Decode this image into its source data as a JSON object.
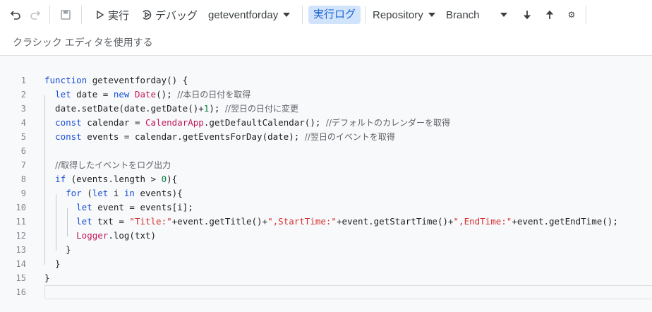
{
  "toolbar": {
    "undo_icon": "undo-icon",
    "redo_icon": "redo-icon",
    "save_icon": "save-icon",
    "run_label": "実行",
    "debug_label": "デバッグ",
    "function_select": "geteventforday",
    "log_label": "実行ログ",
    "repository_label": "Repository",
    "branch_label": "Branch",
    "download_icon": "arrow-down-icon",
    "upload_icon": "arrow-up-icon",
    "settings_icon": "gear-icon"
  },
  "classic_editor_label": "クラシック エディタを使用する",
  "colors": {
    "keyword": "#1a4fd7",
    "string": "#d32f2f",
    "class": "#c2185b",
    "number": "#0b8043",
    "comment": "#5f6368",
    "active_button_bg": "#d2e3fc",
    "active_button_text": "#1967d2"
  },
  "editor": {
    "lines": [
      {
        "num": "1",
        "tokens": [
          {
            "t": "kw",
            "v": "function"
          },
          {
            "t": "",
            "v": " geteventforday() {"
          }
        ]
      },
      {
        "num": "2",
        "tokens": [
          {
            "t": "",
            "v": "  "
          },
          {
            "t": "kw",
            "v": "let"
          },
          {
            "t": "",
            "v": " date = "
          },
          {
            "t": "kw",
            "v": "new"
          },
          {
            "t": "",
            "v": " "
          },
          {
            "t": "cls",
            "v": "Date"
          },
          {
            "t": "",
            "v": "(); "
          },
          {
            "t": "cm",
            "v": "//本日の日付を取得"
          }
        ]
      },
      {
        "num": "3",
        "tokens": [
          {
            "t": "",
            "v": "  date.setDate(date.getDate()+"
          },
          {
            "t": "num",
            "v": "1"
          },
          {
            "t": "",
            "v": "); "
          },
          {
            "t": "cm",
            "v": "//翌日の日付に変更"
          }
        ]
      },
      {
        "num": "4",
        "tokens": [
          {
            "t": "",
            "v": "  "
          },
          {
            "t": "kw",
            "v": "const"
          },
          {
            "t": "",
            "v": " calendar = "
          },
          {
            "t": "cls",
            "v": "CalendarApp"
          },
          {
            "t": "",
            "v": ".getDefaultCalendar(); "
          },
          {
            "t": "cm",
            "v": "//デフォルトのカレンダーを取得"
          }
        ]
      },
      {
        "num": "5",
        "tokens": [
          {
            "t": "",
            "v": "  "
          },
          {
            "t": "kw",
            "v": "const"
          },
          {
            "t": "",
            "v": " events = calendar.getEventsForDay(date); "
          },
          {
            "t": "cm",
            "v": "//翌日のイベントを取得"
          }
        ]
      },
      {
        "num": "6",
        "tokens": []
      },
      {
        "num": "7",
        "tokens": [
          {
            "t": "",
            "v": "  "
          },
          {
            "t": "cm",
            "v": "//取得したイベントをログ出力"
          }
        ]
      },
      {
        "num": "8",
        "tokens": [
          {
            "t": "",
            "v": "  "
          },
          {
            "t": "kw",
            "v": "if"
          },
          {
            "t": "",
            "v": " (events.length > "
          },
          {
            "t": "num",
            "v": "0"
          },
          {
            "t": "",
            "v": "){"
          }
        ]
      },
      {
        "num": "9",
        "tokens": [
          {
            "t": "",
            "v": "    "
          },
          {
            "t": "kw",
            "v": "for"
          },
          {
            "t": "",
            "v": " ("
          },
          {
            "t": "kw",
            "v": "let"
          },
          {
            "t": "",
            "v": " i "
          },
          {
            "t": "kw",
            "v": "in"
          },
          {
            "t": "",
            "v": " events){"
          }
        ]
      },
      {
        "num": "10",
        "tokens": [
          {
            "t": "",
            "v": "      "
          },
          {
            "t": "kw",
            "v": "let"
          },
          {
            "t": "",
            "v": " event = events[i];"
          }
        ]
      },
      {
        "num": "11",
        "tokens": [
          {
            "t": "",
            "v": "      "
          },
          {
            "t": "kw",
            "v": "let"
          },
          {
            "t": "",
            "v": " txt = "
          },
          {
            "t": "str",
            "v": "\"Title:\""
          },
          {
            "t": "",
            "v": "+event.getTitle()+"
          },
          {
            "t": "str",
            "v": "\",StartTime:\""
          },
          {
            "t": "",
            "v": "+event.getStartTime()+"
          },
          {
            "t": "str",
            "v": "\",EndTime:\""
          },
          {
            "t": "",
            "v": "+event.getEndTime();"
          }
        ]
      },
      {
        "num": "12",
        "tokens": [
          {
            "t": "",
            "v": "      "
          },
          {
            "t": "cls",
            "v": "Logger"
          },
          {
            "t": "",
            "v": ".log(txt)"
          }
        ]
      },
      {
        "num": "13",
        "tokens": [
          {
            "t": "",
            "v": "    }"
          }
        ]
      },
      {
        "num": "14",
        "tokens": [
          {
            "t": "",
            "v": "  }"
          }
        ]
      },
      {
        "num": "15",
        "tokens": [
          {
            "t": "",
            "v": "}"
          }
        ]
      },
      {
        "num": "16",
        "tokens": []
      }
    ]
  }
}
